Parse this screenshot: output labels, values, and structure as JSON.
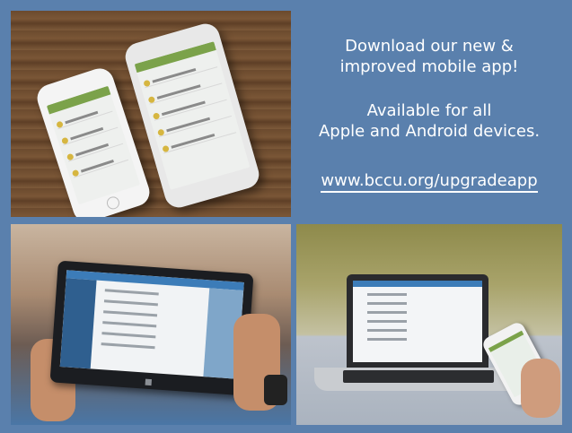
{
  "promo": {
    "headline": [
      "Download our new &",
      "improved mobile app!"
    ],
    "subline": [
      "Available for all",
      "Apple and Android devices."
    ],
    "url": "www.bccu.org/upgradeapp"
  },
  "colors": {
    "background": "#5a80ad",
    "promo_text": "#ffffff",
    "app_header_green": "#7ba24a",
    "app_accent_blue": "#3c7cb8"
  }
}
